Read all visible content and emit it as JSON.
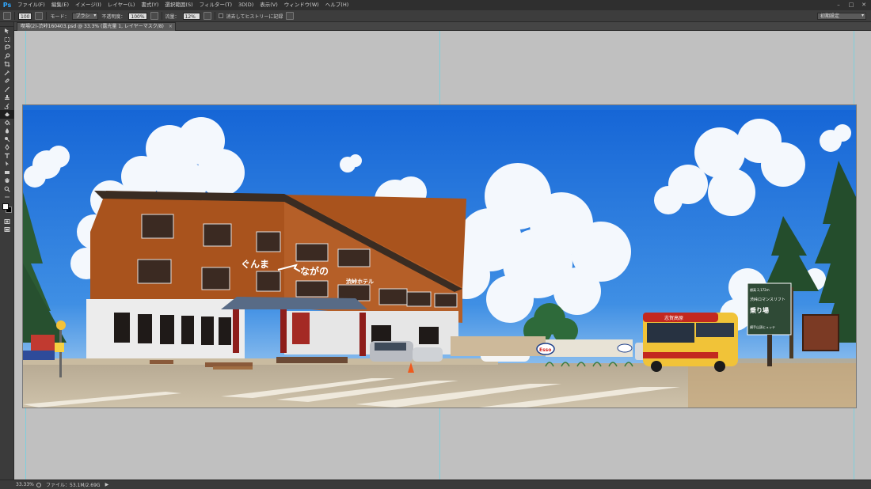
{
  "app": {
    "logo": "Ps",
    "menu": [
      "ファイル(F)",
      "編集(E)",
      "イメージ(I)",
      "レイヤー(L)",
      "書式(Y)",
      "選択範囲(S)",
      "フィルター(T)",
      "3D(D)",
      "表示(V)",
      "ウィンドウ(W)",
      "ヘルプ(H)"
    ],
    "window_controls": [
      "–",
      "□",
      "✕"
    ]
  },
  "options": {
    "brush_size": "100",
    "mode_label": "モード：",
    "mode_value": "ブラシ",
    "opacity_label": "不透明度：",
    "opacity_value": "100%",
    "flow_label": "流量：",
    "flow_value": "12%",
    "history_label": "消去してヒストリーに記録",
    "workspace": "初期設定"
  },
  "document": {
    "tab_title": "喫場(2)-渋峠160403.psd @ 33.3% (露光量 1, レイヤーマスク/8)",
    "close_icon": "×",
    "image_text": {
      "left_pref": "ぐんま",
      "right_pref": "ながの",
      "hotel_sign": "渋峠ホテル",
      "station_line1": "標高 2,172m",
      "station_line2": "渋峠ロマンスリフト",
      "station_line3": "乗り場",
      "station_line4": "横手山頂ヒュッテ",
      "bus_sign": "志賀高原",
      "esso": "Esso"
    }
  },
  "status": {
    "zoom": "33.33%",
    "file_info": "ファイル：53.1M/2.69G"
  },
  "colors": {
    "sky_top": "#1565d6",
    "sky_bottom": "#4a95e6",
    "hotel_wood": "#a9531d",
    "bus_yellow": "#f1c338",
    "bus_red": "#c3281f",
    "guide": "#62d4e8"
  }
}
